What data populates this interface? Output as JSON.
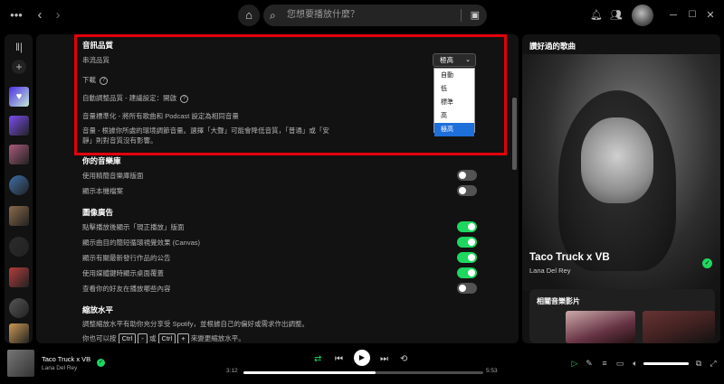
{
  "topbar": {
    "more_icon": "more-icon",
    "back_icon": "back-icon",
    "forward_icon": "forward-icon",
    "home_icon": "home-icon",
    "search_placeholder": "您想要播放什麼？",
    "browse_icon": "browse-icon",
    "notifications_icon": "bell-icon",
    "friends_icon": "friends-icon"
  },
  "window": {
    "minimize": "─",
    "maximize": "☐",
    "close": "✕"
  },
  "sidebar": {
    "library_icon": "library-icon",
    "add_icon": "plus-icon",
    "thumb_colors": [
      "#7a4cf0",
      "#a85a7a",
      "#3d6fa8",
      "#8a6a4a",
      "#2b2b2b",
      "#b43c3c",
      "#555555",
      "#cc9955",
      "#7c6d61",
      "#4e6b8c"
    ]
  },
  "settings": {
    "audio_quality": {
      "heading": "音訊品質",
      "streaming_label": "串流品質",
      "download_label": "下載",
      "auto_adjust_label": "自動調整品質 - 建議設定：開啟",
      "normalize_label": "音量標準化 - 將所有歌曲和 Podcast 設定為相同音量",
      "volume_level_line1": "音量 - 根據你所處的環境調節音量。選擇「大聲」可能會降低音質，「普通」或「安",
      "volume_level_line2": "靜」則對音質沒有影響。",
      "streaming_value": "極高",
      "options": [
        "自動",
        "低",
        "標準",
        "高",
        "極高"
      ],
      "selected_option": "極高"
    },
    "library": {
      "heading": "你的音樂庫",
      "compact_label": "使用精簡音樂庫版面",
      "local_files_label": "顯示本機檔案",
      "compact_on": false,
      "local_files_on": false
    },
    "display": {
      "heading": "圖像廣告",
      "now_playing_label": "點擊播放後顯示「現正播放」版面",
      "canvas_label": "顯示曲目的簡短循環視覺效果 (Canvas)",
      "announcements_label": "顯示有關最新發行作品的公告",
      "desktop_overlay_label": "使用媒體鍵時顯示桌面覆蓋",
      "friends_label": "查看你的好友在播放哪些內容",
      "now_playing_on": true,
      "canvas_on": true,
      "announcements_on": true,
      "desktop_overlay_on": true,
      "friends_on": false
    },
    "zoom": {
      "heading": "縮放水平",
      "desc": "調整縮放水平有助你充分享受 Spotify，並根據自己的偏好或需求作出調整。",
      "hint_prefix": "你也可以按",
      "key_ctrl": "Ctrl",
      "key_minus": "-",
      "or": "或",
      "key_plus": "+",
      "hint_suffix": "來變更縮放水平。"
    }
  },
  "right_panel": {
    "title": "讚好過的歌曲",
    "song": "Taco Truck x VB",
    "artist": "Lana Del Rey",
    "videos_heading": "相關音樂影片"
  },
  "player": {
    "title": "Taco Truck x VB",
    "artist": "Lana Del Rey",
    "elapsed": "3:12",
    "duration": "5:53",
    "progress": 0.55,
    "volume": 1.0,
    "shuffle_icon": "shuffle-icon",
    "prev_icon": "previous-icon",
    "play_icon": "play-icon",
    "next_icon": "next-icon",
    "repeat_icon": "repeat-icon"
  },
  "colors": {
    "accent": "#1ed760",
    "highlight": "#e3000b",
    "selection": "#1e6fd9"
  }
}
